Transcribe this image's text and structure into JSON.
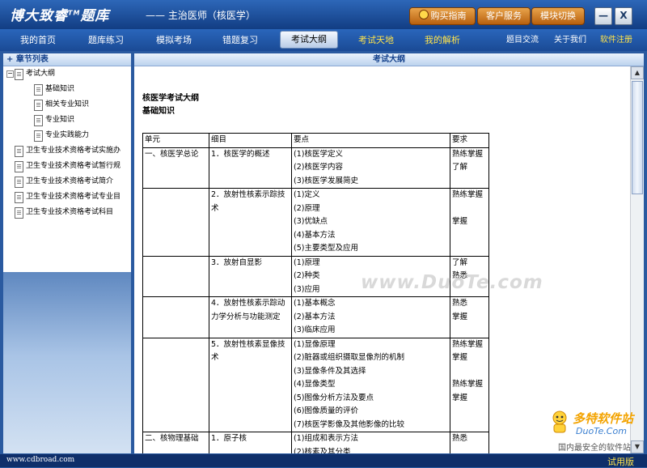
{
  "app": {
    "logo": "博大致睿",
    "logo_tm": "TM",
    "logo_suffix": "题库",
    "subtitle": "—— 主治医师（核医学）"
  },
  "top_buttons": [
    "购买指南",
    "客户服务",
    "模块切换"
  ],
  "window_buttons": {
    "minimize": "—",
    "close": "X"
  },
  "nav": {
    "items": [
      "我的首页",
      "题库练习",
      "模拟考场",
      "错题复习",
      "考试大纲",
      "考试天地",
      "我的解析"
    ],
    "active_index": 4,
    "right_items": [
      "题目交流",
      "关于我们",
      "软件注册"
    ]
  },
  "sidebar": {
    "title": "章节列表",
    "root": "考试大纲",
    "children": [
      "基础知识",
      "相关专业知识",
      "专业知识",
      "专业实践能力"
    ],
    "items": [
      "卫生专业技术资格考试实施办",
      "卫生专业技术资格考试暂行规",
      "卫生专业技术资格考试简介",
      "卫生专业技术资格考试专业目",
      "卫生专业技术资格考试科目"
    ]
  },
  "main": {
    "header": "考试大纲",
    "doc_title": "核医学考试大纲",
    "section": "基础知识",
    "watermark": "www.DuoTe.com",
    "table": {
      "headers": [
        "单元",
        "细目",
        "要点",
        "要求"
      ],
      "rows": [
        {
          "unit": "一、核医学总论",
          "item": "1．核医学的概述",
          "points": [
            "(1)核医学定义",
            "(2)核医学内容",
            "(3)核医学发展简史"
          ],
          "req": [
            "熟练掌握",
            "了解",
            ""
          ]
        },
        {
          "unit": "",
          "item": "2．放射性核素示踪技术",
          "points": [
            "(1)定义",
            "(2)原理",
            "(3)优缺点",
            "(4)基本方法",
            "(5)主要类型及应用"
          ],
          "req": [
            "熟练掌握",
            "",
            "掌握",
            "",
            ""
          ]
        },
        {
          "unit": "",
          "item": "3．放射自显影",
          "points": [
            "(1)原理",
            "(2)种类",
            "(3)应用"
          ],
          "req": [
            "了解",
            "熟悉",
            ""
          ]
        },
        {
          "unit": "",
          "item": "4．放射性核素示踪动力学分析与功能测定",
          "points": [
            "(1)基本概念",
            "(2)基本方法",
            "(3)临床应用"
          ],
          "req": [
            "熟悉",
            "掌握",
            ""
          ]
        },
        {
          "unit": "",
          "item": "5．放射性核素显像技术",
          "points": [
            "(1)显像原理",
            "(2)脏器或组织摄取显像剂的机制",
            "(3)显像条件及其选择",
            "(4)显像类型",
            "(5)图像分析方法及要点",
            "(6)图像质量的评价",
            "(7)核医学影像及其他影像的比较"
          ],
          "req": [
            "熟练掌握",
            "掌握",
            "",
            "熟练掌握",
            "掌握",
            "",
            ""
          ]
        },
        {
          "unit": "二、核物理基础",
          "item": "1．原子核",
          "points": [
            "(1)组成和表示方法",
            "(2)核素及其分类"
          ],
          "req": [
            "熟悉",
            ""
          ]
        }
      ]
    }
  },
  "brand": {
    "name": "多特软件站",
    "url": "DuoTe.Com",
    "slogan": "国内最安全的软件站"
  },
  "status": {
    "url": "www.cdbroad.com",
    "trial": "试用版"
  },
  "colors": {
    "nav_bg": "#1a4a95",
    "accent_yellow": "#ffe34b",
    "button_orange": "#d07a22"
  }
}
